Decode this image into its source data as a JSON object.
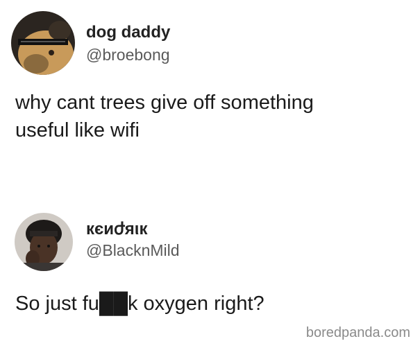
{
  "tweets": [
    {
      "display_name": "dog daddy",
      "handle": "@broebong",
      "text": "why cant trees give off something\nuseful like wifi",
      "avatar_icon": "dog-photo-avatar"
    },
    {
      "display_name": "кєиժяιк",
      "handle": "@BlacknMild",
      "text": "So just fu██k oxygen right?",
      "avatar_icon": "person-photo-avatar"
    }
  ],
  "watermark": "boredpanda.com",
  "colors": {
    "background": "#ffffff",
    "text": "#1a1a1a",
    "handle": "#5a5a5a",
    "watermark": "#8a8a8a"
  }
}
